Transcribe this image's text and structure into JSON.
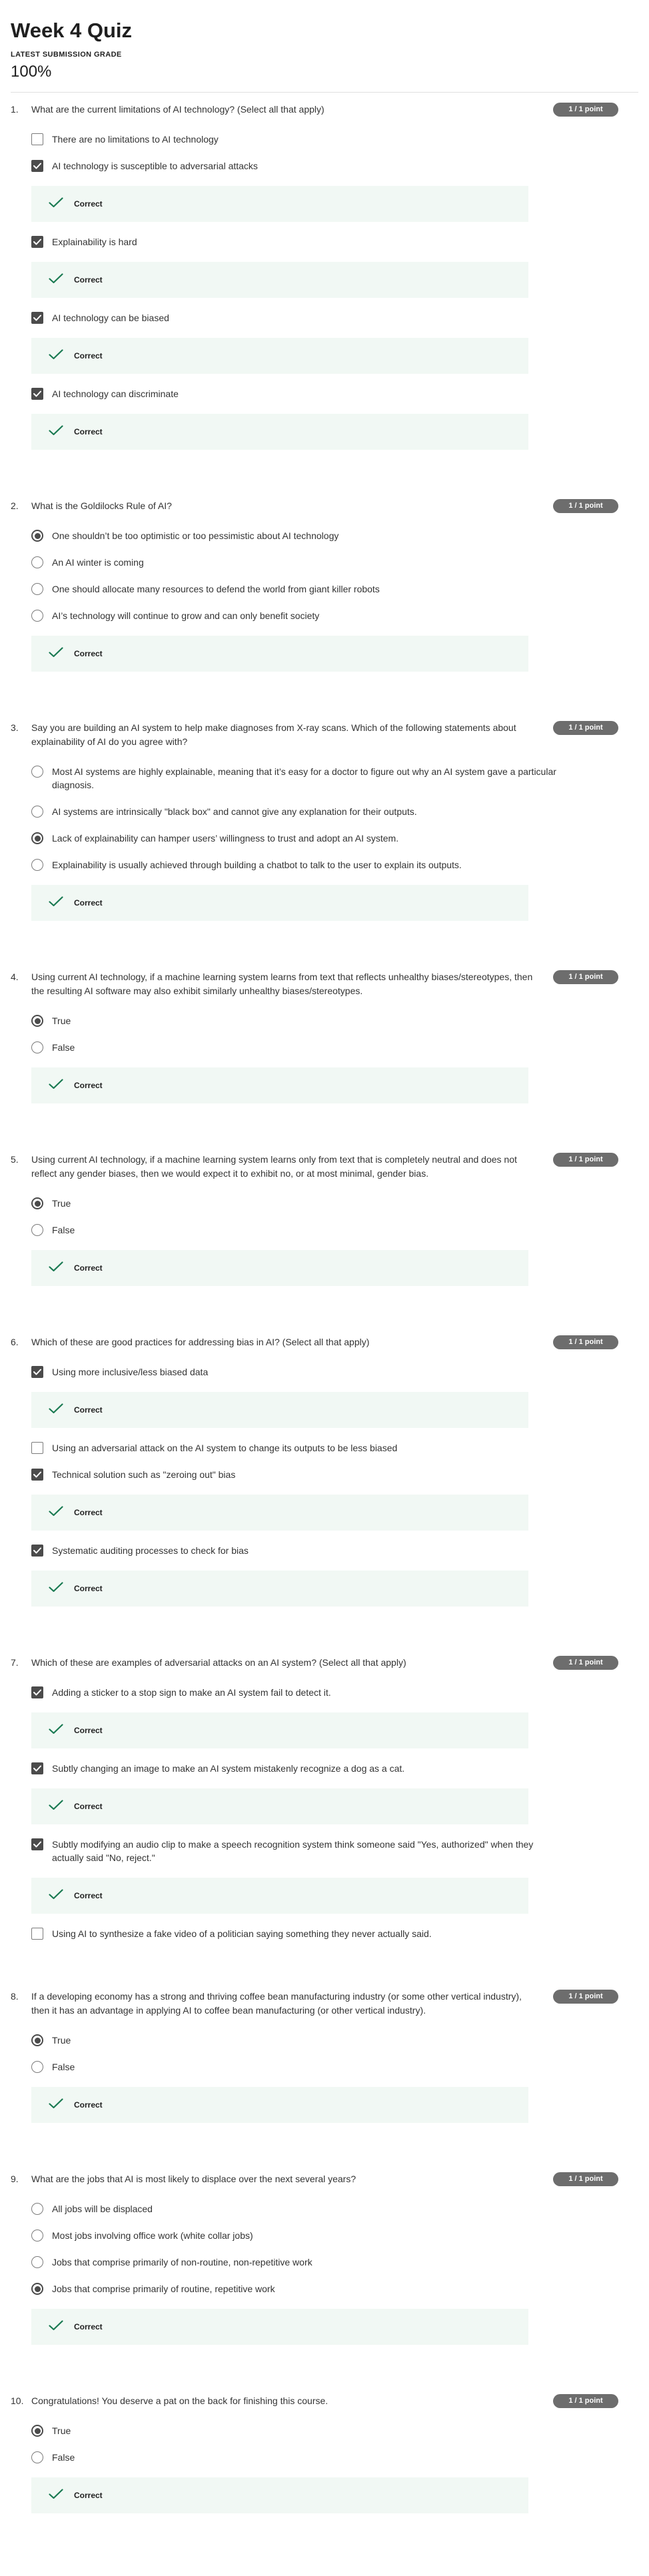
{
  "quiz": {
    "title": "Week 4 Quiz",
    "grade_label": "LATEST SUBMISSION GRADE",
    "grade_value": "100%"
  },
  "feedback_label": "Correct",
  "colors": {
    "feedback_bg": "#f1f8f4",
    "check_green": "#1a7a52",
    "points_badge": "#6d6d6d"
  },
  "questions": [
    {
      "number": "1.",
      "text": "What are the current limitations of AI technology? (Select all that apply)",
      "points": "1 / 1 point",
      "input_type": "checkbox",
      "options": [
        {
          "text": "There are no limitations to AI technology",
          "selected": false,
          "feedback": false
        },
        {
          "text": "AI technology is susceptible to adversarial attacks",
          "selected": true,
          "feedback": true
        },
        {
          "text": "Explainability is hard",
          "selected": true,
          "feedback": true
        },
        {
          "text": "AI technology can be biased",
          "selected": true,
          "feedback": true
        },
        {
          "text": "AI technology can discriminate",
          "selected": true,
          "feedback": true
        }
      ]
    },
    {
      "number": "2.",
      "text": "What is the Goldilocks Rule of AI?",
      "points": "1 / 1 point",
      "input_type": "radio",
      "options": [
        {
          "text": "One shouldn’t be too optimistic or too pessimistic about AI technology",
          "selected": true,
          "feedback": false
        },
        {
          "text": "An AI winter is coming",
          "selected": false,
          "feedback": false
        },
        {
          "text": "One should allocate many resources to defend the world from giant killer robots",
          "selected": false,
          "feedback": false
        },
        {
          "text": "AI’s technology will continue to grow and can only benefit society",
          "selected": false,
          "feedback": false
        }
      ],
      "final_feedback": true
    },
    {
      "number": "3.",
      "text": "Say you are building an AI system to help make diagnoses from X-ray scans. Which of the following statements about explainability of AI do you agree with?",
      "points": "1 / 1 point",
      "input_type": "radio",
      "options": [
        {
          "text": "Most AI systems are highly explainable, meaning that it’s easy for a doctor to figure out why an AI system gave a particular diagnosis.",
          "selected": false,
          "feedback": false
        },
        {
          "text": "AI systems are intrinsically \"black box\" and cannot give any explanation for their outputs.",
          "selected": false,
          "feedback": false
        },
        {
          "text": "Lack of explainability can hamper users’ willingness to trust and adopt an AI system.",
          "selected": true,
          "feedback": false
        },
        {
          "text": "Explainability is usually achieved through building a chatbot to talk to the user to explain its outputs.",
          "selected": false,
          "feedback": false
        }
      ],
      "final_feedback": true
    },
    {
      "number": "4.",
      "text": "Using current AI technology, if a machine learning system learns from text that reflects unhealthy biases/stereotypes, then the resulting AI software may also exhibit similarly unhealthy biases/stereotypes.",
      "points": "1 / 1 point",
      "input_type": "radio",
      "options": [
        {
          "text": "True",
          "selected": true,
          "feedback": false
        },
        {
          "text": "False",
          "selected": false,
          "feedback": false
        }
      ],
      "final_feedback": true
    },
    {
      "number": "5.",
      "text": "Using current AI technology, if a machine learning system learns only from text that is completely neutral and does not reflect any gender biases, then we would expect it to exhibit no, or at most minimal, gender bias.",
      "points": "1 / 1 point",
      "input_type": "radio",
      "options": [
        {
          "text": "True",
          "selected": true,
          "feedback": false
        },
        {
          "text": "False",
          "selected": false,
          "feedback": false
        }
      ],
      "final_feedback": true
    },
    {
      "number": "6.",
      "text": "Which of these are good practices for addressing bias in AI? (Select all that apply)",
      "points": "1 / 1 point",
      "input_type": "checkbox",
      "options": [
        {
          "text": "Using more inclusive/less biased data",
          "selected": true,
          "feedback": true
        },
        {
          "text": "Using an adversarial attack on the AI system to change its outputs to be less biased",
          "selected": false,
          "feedback": false
        },
        {
          "text": "Technical solution such as \"zeroing out\" bias",
          "selected": true,
          "feedback": true
        },
        {
          "text": "Systematic auditing processes to check for bias",
          "selected": true,
          "feedback": true
        }
      ]
    },
    {
      "number": "7.",
      "text": "Which of these are examples of adversarial attacks on an AI system? (Select all that apply)",
      "points": "1 / 1 point",
      "input_type": "checkbox",
      "options": [
        {
          "text": "Adding a sticker to a stop sign to make an AI system fail to detect it.",
          "selected": true,
          "feedback": true
        },
        {
          "text": "Subtly changing an image to make an AI system mistakenly recognize a dog as a cat.",
          "selected": true,
          "feedback": true
        },
        {
          "text": "Subtly modifying an audio clip to make a speech recognition system think someone said \"Yes, authorized\" when they actually said \"No, reject.\"",
          "selected": true,
          "feedback": true
        },
        {
          "text": "Using AI to synthesize a fake video of a politician saying something they never actually said.",
          "selected": false,
          "feedback": false
        }
      ]
    },
    {
      "number": "8.",
      "text": "If a developing economy has a strong and thriving coffee bean manufacturing industry (or some other vertical industry), then it has an advantage in applying AI to coffee bean manufacturing (or other vertical industry).",
      "points": "1 / 1 point",
      "input_type": "radio",
      "options": [
        {
          "text": "True",
          "selected": true,
          "feedback": false
        },
        {
          "text": "False",
          "selected": false,
          "feedback": false
        }
      ],
      "final_feedback": true
    },
    {
      "number": "9.",
      "text": "What are the jobs that AI is most likely to displace over the next several years?",
      "points": "1 / 1 point",
      "input_type": "radio",
      "options": [
        {
          "text": "All jobs will be displaced",
          "selected": false,
          "feedback": false
        },
        {
          "text": "Most jobs involving office work (white collar jobs)",
          "selected": false,
          "feedback": false
        },
        {
          "text": "Jobs that comprise primarily of non-routine, non-repetitive work",
          "selected": false,
          "feedback": false
        },
        {
          "text": "Jobs that comprise primarily of routine, repetitive work",
          "selected": true,
          "feedback": false
        }
      ],
      "final_feedback": true
    },
    {
      "number": "10.",
      "text": "Congratulations! You deserve a pat on the back for finishing this course.",
      "points": "1 / 1 point",
      "input_type": "radio",
      "options": [
        {
          "text": "True",
          "selected": true,
          "feedback": false
        },
        {
          "text": "False",
          "selected": false,
          "feedback": false
        }
      ],
      "final_feedback": true
    }
  ]
}
